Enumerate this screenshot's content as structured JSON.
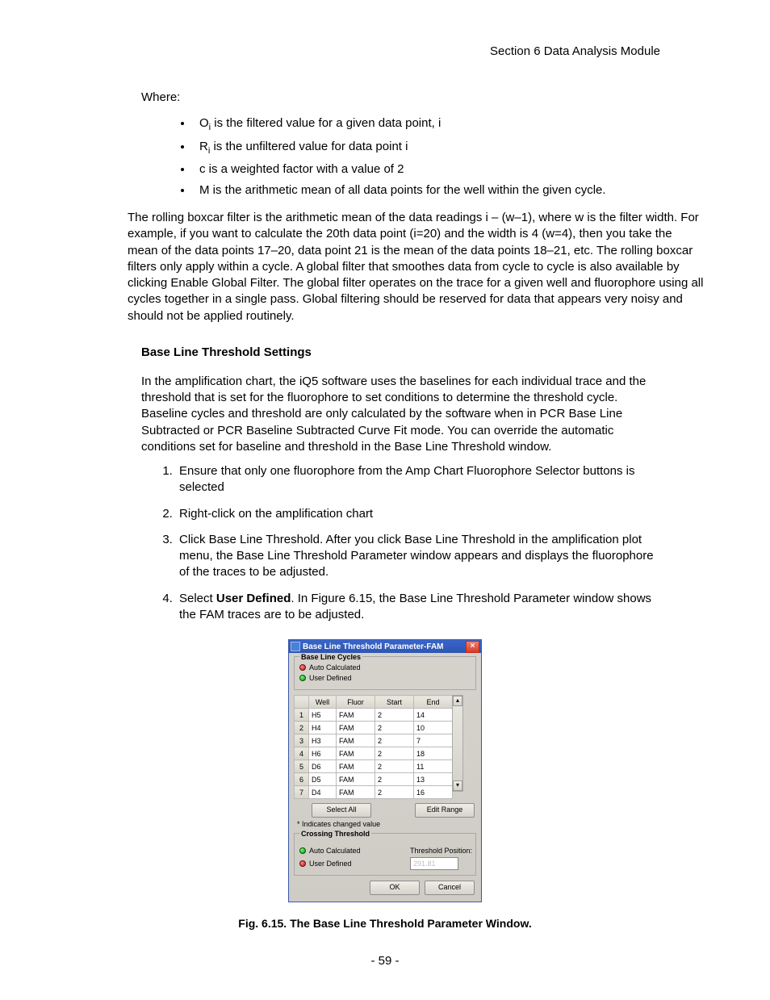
{
  "header": "Section 6 Data Analysis Module",
  "whereLabel": "Where:",
  "definitions": {
    "o": "is the filtered value for a given data point, i",
    "r": "is the unfiltered value for data point i",
    "c": "c is a weighted factor with a value of 2",
    "m": "M is the arithmetic mean of all data points for the well within the given cycle."
  },
  "paragraph_filter": "The rolling boxcar filter is the arithmetic mean of the data readings i – (w–1), where w is the filter width. For example, if you want to calculate the 20th data point (i=20) and the width is 4 (w=4), then you take the mean of the data points 17–20, data point 21 is the mean of the data points 18–21, etc. The rolling boxcar filters only apply within a cycle. A global filter that smoothes data from cycle to cycle is also available by clicking Enable Global Filter. The global filter operates on the trace for a given well and fluorophore using all cycles together in a single pass. Global filtering should be reserved for data that appears very noisy and should not be applied routinely.",
  "section_heading": "Base Line Threshold Settings",
  "paragraph_baseline": "In the amplification chart, the iQ5 software uses the baselines for each individual trace and the threshold that is set for the fluorophore to set conditions to determine the threshold cycle. Baseline cycles and threshold are only calculated by the software when in PCR Base Line Subtracted or PCR Baseline Subtracted Curve Fit mode. You can override the automatic conditions set for baseline and threshold in the Base Line Threshold window.",
  "steps": {
    "s1": "Ensure that only one fluorophore from the Amp Chart Fluorophore Selector buttons is selected",
    "s2": "Right-click on the amplification chart",
    "s3": "Click Base Line Threshold. After you click Base Line Threshold in the amplification plot menu, the Base Line Threshold Parameter window appears and displays the fluorophore of the traces to be adjusted.",
    "s4_pre": "Select ",
    "s4_bold": "User Defined",
    "s4_post": ". In Figure 6.15, the Base Line Threshold Parameter window shows the FAM traces are to be adjusted."
  },
  "dialog": {
    "title": "Base Line Threshold Parameter-FAM",
    "close": "×",
    "group_cycles": "Base Line Cycles",
    "radio_auto": "Auto Calculated",
    "radio_user": "User Defined",
    "columns": {
      "well": "Well",
      "fluor": "Fluor",
      "start": "Start",
      "end": "End"
    },
    "rows": [
      {
        "n": "1",
        "well": "H5",
        "fluor": "FAM",
        "start": "2",
        "end": "14"
      },
      {
        "n": "2",
        "well": "H4",
        "fluor": "FAM",
        "start": "2",
        "end": "10"
      },
      {
        "n": "3",
        "well": "H3",
        "fluor": "FAM",
        "start": "2",
        "end": "7"
      },
      {
        "n": "4",
        "well": "H6",
        "fluor": "FAM",
        "start": "2",
        "end": "18"
      },
      {
        "n": "5",
        "well": "D6",
        "fluor": "FAM",
        "start": "2",
        "end": "11"
      },
      {
        "n": "6",
        "well": "D5",
        "fluor": "FAM",
        "start": "2",
        "end": "13"
      },
      {
        "n": "7",
        "well": "D4",
        "fluor": "FAM",
        "start": "2",
        "end": "16"
      }
    ],
    "select_all": "Select All",
    "edit_range": "Edit Range",
    "changed_note": "* Indicates changed value",
    "group_thresh": "Crossing Threshold",
    "thresh_auto": "Auto Calculated",
    "thresh_user": "User Defined",
    "thresh_pos_label": "Threshold Position:",
    "thresh_value": "291.81",
    "ok": "OK",
    "cancel": "Cancel",
    "scroll_up": "▴",
    "scroll_down": "▾"
  },
  "figure_caption": "Fig. 6.15. The Base Line Threshold Parameter Window.",
  "page_number": "- 59 -"
}
